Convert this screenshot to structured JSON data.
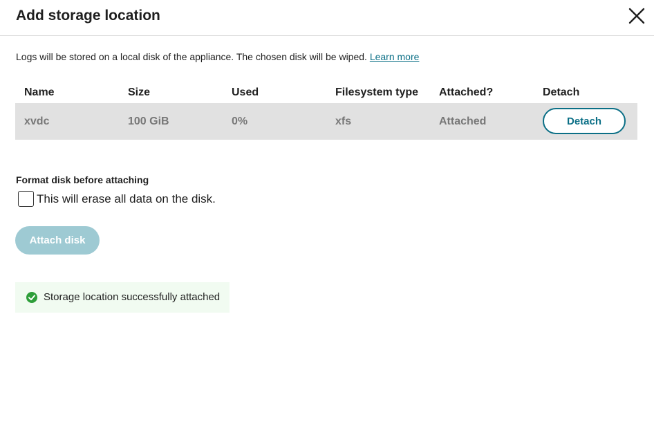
{
  "dialog": {
    "title": "Add storage location",
    "close_icon": "close-icon"
  },
  "description": {
    "text": "Logs will be stored on a local disk of the appliance. The chosen disk will be wiped. ",
    "learn_more": "Learn more"
  },
  "table": {
    "headers": [
      "Name",
      "Size",
      "Used",
      "Filesystem type",
      "Attached?",
      "Detach"
    ],
    "rows": [
      {
        "name": "xvdc",
        "size": "100 GiB",
        "used": "0%",
        "filesystem": "xfs",
        "attached": "Attached",
        "detach_label": "Detach"
      }
    ]
  },
  "format": {
    "label": "Format disk before attaching",
    "checkbox_text": "This will erase all data on the disk.",
    "checked": false
  },
  "attach_button": {
    "label": "Attach disk"
  },
  "toast": {
    "icon": "check-circle-icon",
    "message": "Storage location successfully attached"
  },
  "colors": {
    "accent": "#0b6f86",
    "disabled_button": "#9ecad3",
    "success": "#2e9e3a",
    "row_background": "#e1e1e1",
    "toast_background": "#f1fbf1"
  }
}
